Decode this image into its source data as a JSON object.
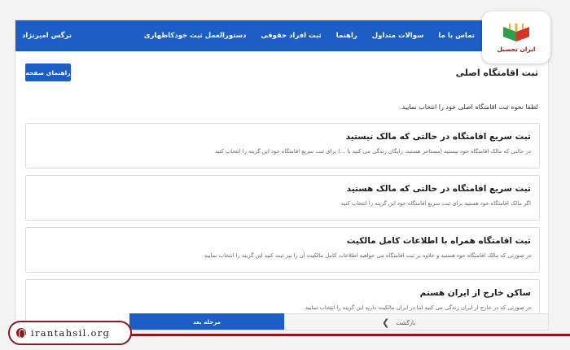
{
  "navbar": {
    "links": [
      "تماس با ما",
      "سوالات متداول",
      "راهنما",
      "ثبت افراد حقوقی",
      "دستورالعمل ثبت خودکاظهاری"
    ],
    "user_name": "نرگس امیرنژاد"
  },
  "page": {
    "title": "ثبت اقامتگاه اصلی",
    "guide_button": "راهنمای صفحه",
    "instruction": "لطفا نحوه ثبت اقامتگاه اصلی خود را انتخاب نمایید."
  },
  "options": [
    {
      "title": "ثبت سریع اقامتگاه در حالتی که مالک نیستید",
      "desc": "در حالتی که مالک اقامتگاه خود نیستید (مستاجر هستید، رایگان زندگی می کنید یا ...) برای ثبت سریع اقامتگاه خود این گزینه را انتخاب کنید"
    },
    {
      "title": "ثبت سریع اقامتگاه در حالتی که مالک هستید",
      "desc": "اگر مالک اقامتگاه خود هستید برای ثبت سریع اقامتگاه خود این گزینه را انتخاب کنید"
    },
    {
      "title": "ثبت اقامتگاه همراه با اطلاعات کامل مالکیت",
      "desc": "در صورتی که مالک اقامتگاه خود هستید و علاوه بر ثبت اقامتگاه می خواهید اطلاعات کامل مالکیت آن را نیز ثبت کنید این گزینه را انتخاب نمایید"
    },
    {
      "title": "ساکن خارج از ایران هستم",
      "desc": "در صورتی که در خارج از ایران زندگی می کنید اما در ایران مالکیت دارید این گزینه را انتخاب نمایید."
    }
  ],
  "bottom": {
    "next_label": "مرحله بعد",
    "back_label": "بازگشت"
  },
  "logo": {
    "text": "ایران تحصیل"
  },
  "footer": {
    "url": "irantahsil.org"
  },
  "colors": {
    "primary": "#1d5ec6",
    "brand": "#8b1a1a"
  }
}
